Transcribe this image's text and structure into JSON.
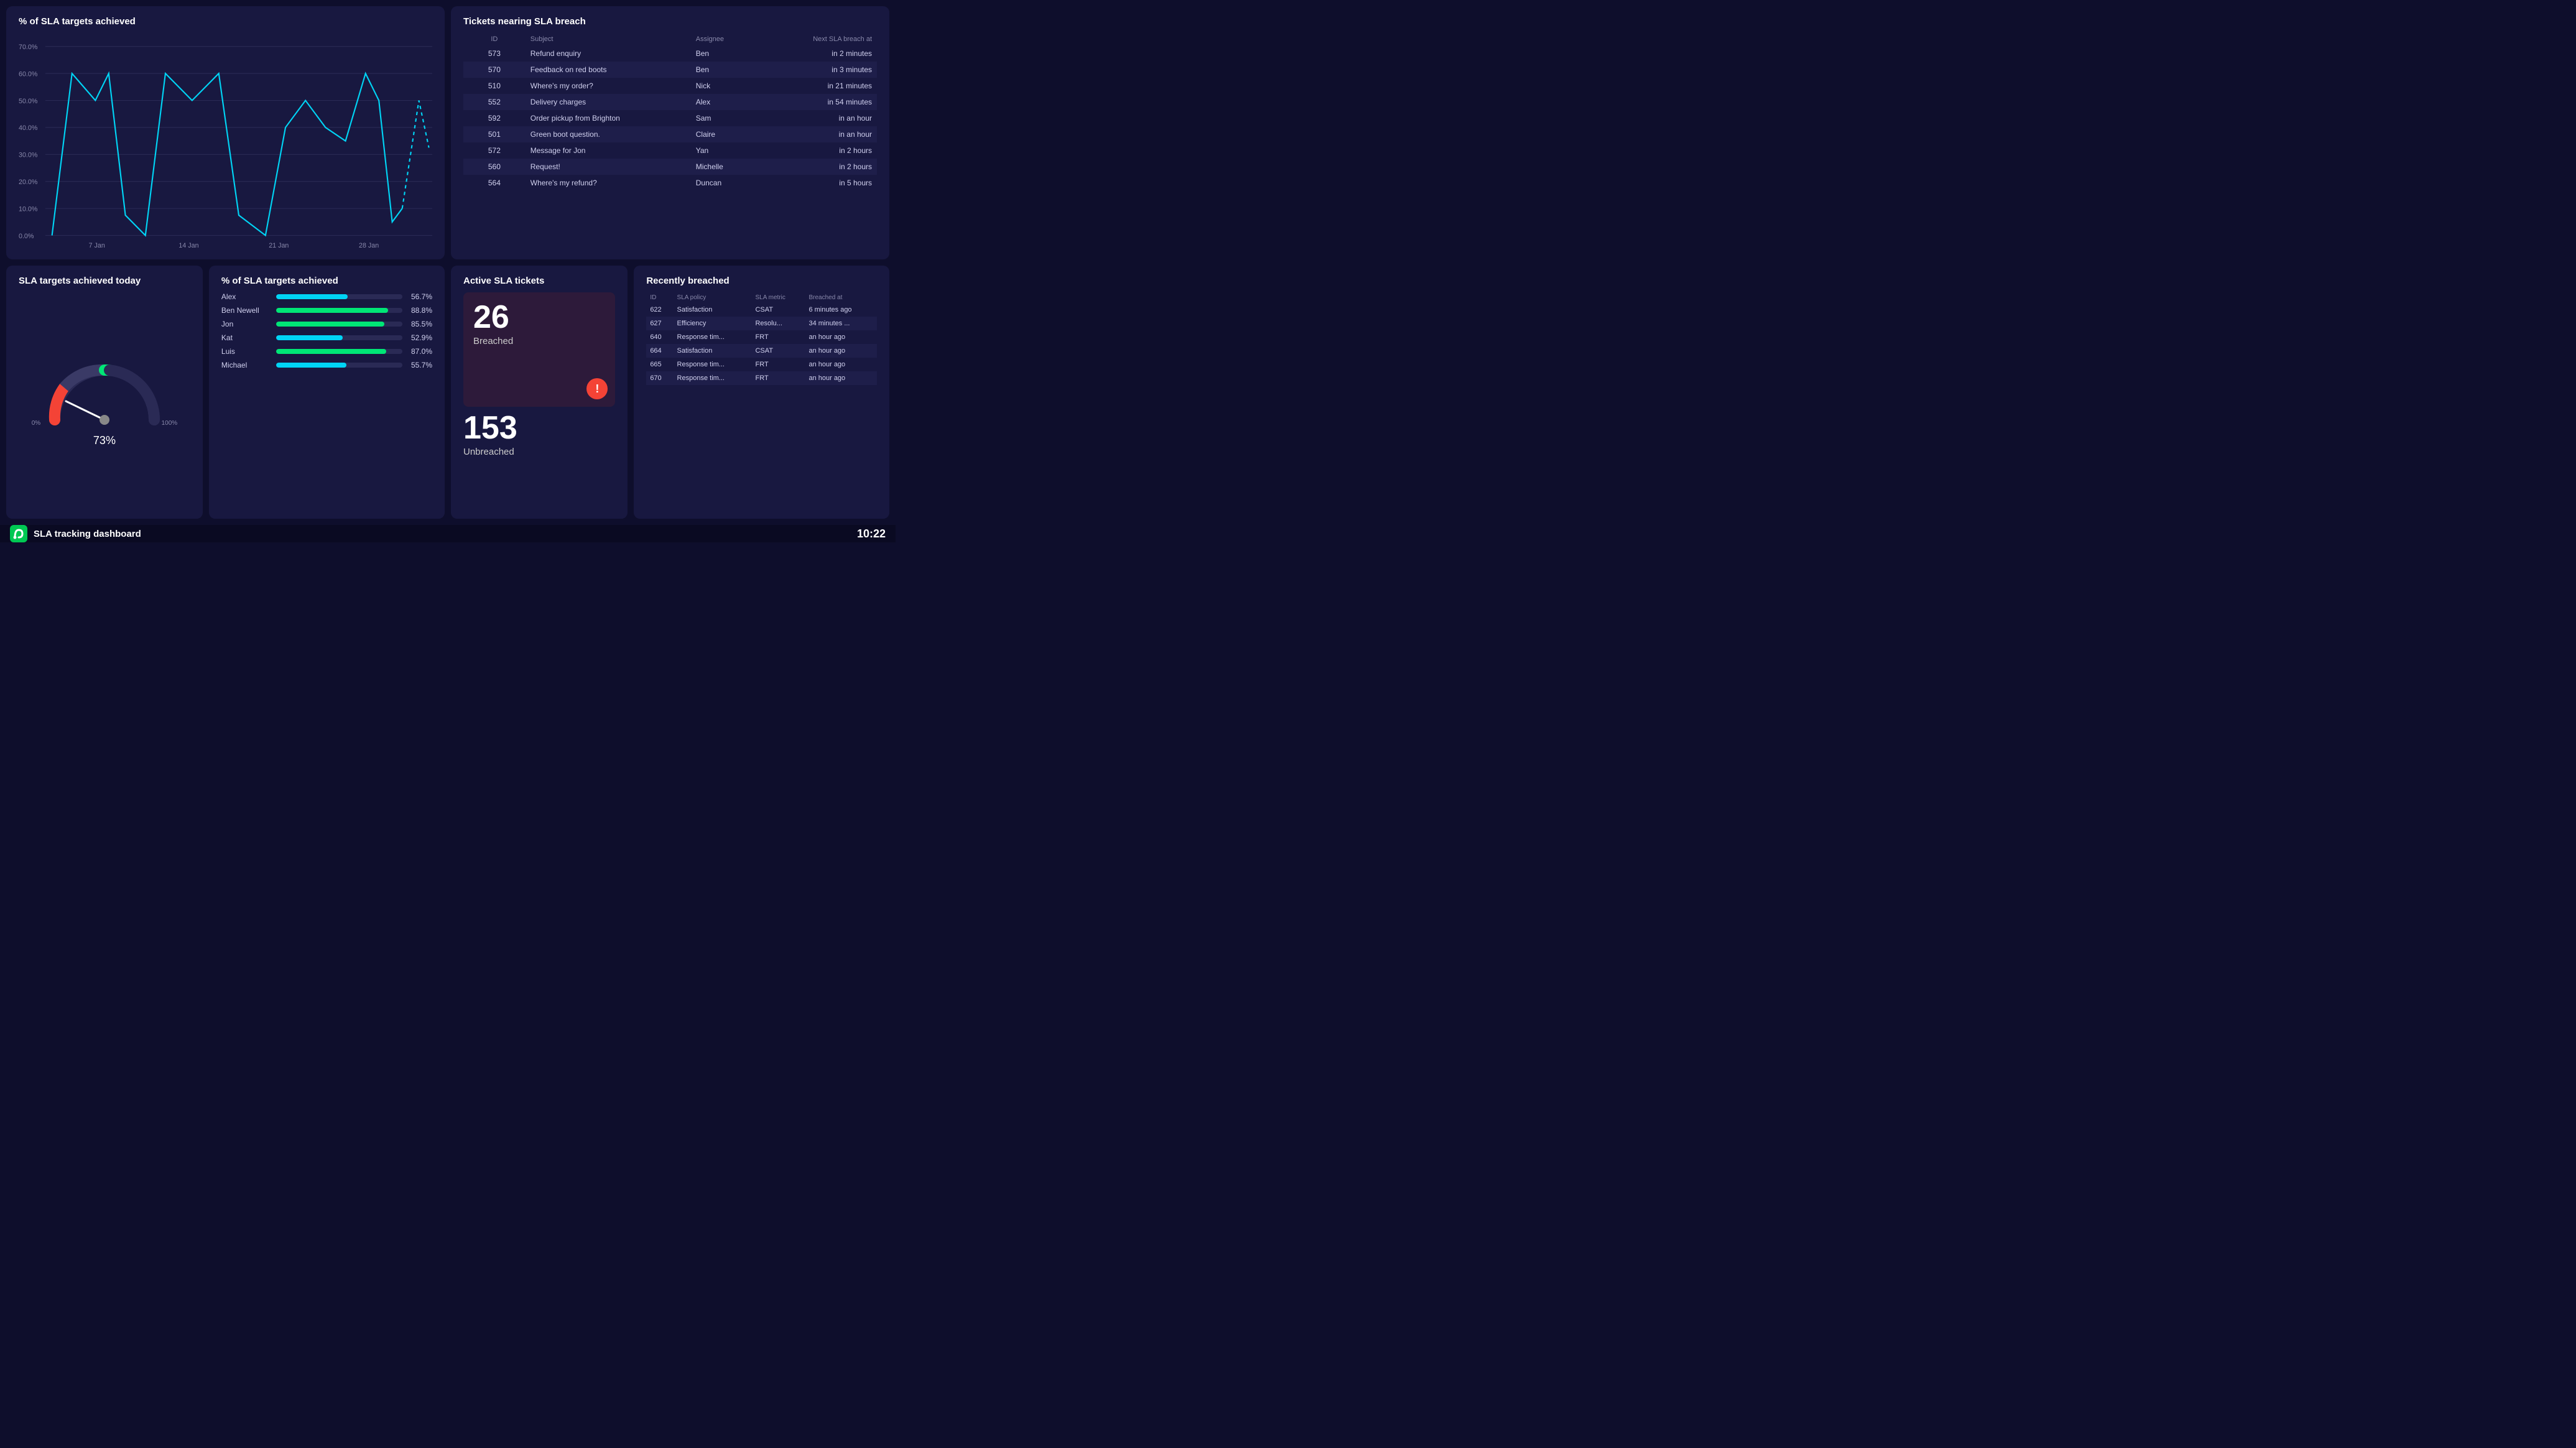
{
  "header": {
    "title": "SLA tracking dashboard",
    "time": "10:22"
  },
  "top_left": {
    "title": "% of SLA targets achieved",
    "y_labels": [
      "70.0%",
      "60.0%",
      "50.0%",
      "40.0%",
      "30.0%",
      "20.0%",
      "10.0%",
      "0.0%"
    ],
    "x_labels": [
      "7 Jan",
      "14 Jan",
      "21 Jan",
      "28 Jan"
    ],
    "chart_points": "solid"
  },
  "top_right": {
    "title": "Tickets nearing SLA breach",
    "columns": [
      "ID",
      "Subject",
      "Assignee",
      "Next SLA breach at"
    ],
    "rows": [
      {
        "id": "573",
        "subject": "Refund enquiry",
        "assignee": "Ben",
        "time": "in 2 minutes"
      },
      {
        "id": "570",
        "subject": "Feedback on red boots",
        "assignee": "Ben",
        "time": "in 3 minutes"
      },
      {
        "id": "510",
        "subject": "Where's my order?",
        "assignee": "Nick",
        "time": "in 21 minutes"
      },
      {
        "id": "552",
        "subject": "Delivery charges",
        "assignee": "Alex",
        "time": "in 54 minutes"
      },
      {
        "id": "592",
        "subject": "Order pickup from Brighton",
        "assignee": "Sam",
        "time": "in an hour"
      },
      {
        "id": "501",
        "subject": "Green boot question.",
        "assignee": "Claire",
        "time": "in an hour"
      },
      {
        "id": "572",
        "subject": "Message for Jon",
        "assignee": "Yan",
        "time": "in 2 hours"
      },
      {
        "id": "560",
        "subject": "Request!",
        "assignee": "Michelle",
        "time": "in 2 hours"
      },
      {
        "id": "564",
        "subject": "Where's my refund?",
        "assignee": "Duncan",
        "time": "in 5 hours"
      }
    ]
  },
  "bottom_left": {
    "title": "SLA targets achieved today",
    "value": "73",
    "unit": "%",
    "min_label": "0%",
    "max_label": "100%"
  },
  "bottom_bar": {
    "title": "% of SLA targets achieved",
    "agents": [
      {
        "name": "Alex",
        "pct": 56.7,
        "pct_label": "56.7%",
        "color": "cyan"
      },
      {
        "name": "Ben Newell",
        "pct": 88.8,
        "pct_label": "88.8%",
        "color": "green"
      },
      {
        "name": "Jon",
        "pct": 85.5,
        "pct_label": "85.5%",
        "color": "green"
      },
      {
        "name": "Kat",
        "pct": 52.9,
        "pct_label": "52.9%",
        "color": "cyan"
      },
      {
        "name": "Luis",
        "pct": 87.0,
        "pct_label": "87.0%",
        "color": "green"
      },
      {
        "name": "Michael",
        "pct": 55.7,
        "pct_label": "55.7%",
        "color": "cyan"
      }
    ]
  },
  "active_sla": {
    "title": "Active SLA tickets",
    "breached_number": "26",
    "breached_label": "Breached",
    "unbreached_number": "153",
    "unbreached_label": "Unbreached"
  },
  "recently_breached": {
    "title": "Recently breached",
    "columns": [
      "ID",
      "SLA policy",
      "SLA metric",
      "Breached at"
    ],
    "rows": [
      {
        "id": "622",
        "policy": "Satisfaction",
        "metric": "CSAT",
        "time": "6 minutes ago"
      },
      {
        "id": "627",
        "policy": "Efficiency",
        "metric": "Resolu...",
        "time": "34 minutes ..."
      },
      {
        "id": "640",
        "policy": "Response tim...",
        "metric": "FRT",
        "time": "an hour ago"
      },
      {
        "id": "664",
        "policy": "Satisfaction",
        "metric": "CSAT",
        "time": "an hour ago"
      },
      {
        "id": "665",
        "policy": "Response tim...",
        "metric": "FRT",
        "time": "an hour ago"
      },
      {
        "id": "670",
        "policy": "Response tim...",
        "metric": "FRT",
        "time": "an hour ago"
      }
    ]
  }
}
